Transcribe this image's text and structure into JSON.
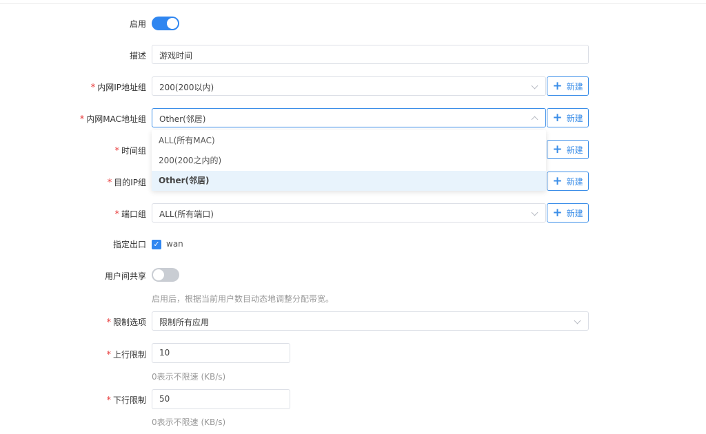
{
  "form": {
    "enable": {
      "label": "启用",
      "on": true
    },
    "description": {
      "label": "描述",
      "value": "游戏时间"
    },
    "ip_group": {
      "required": "*",
      "label": "内网IP地址组",
      "value": "200(200以内)",
      "new_label": "新建"
    },
    "mac_group": {
      "required": "*",
      "label": "内网MAC地址组",
      "value": "Other(邻居)",
      "new_label": "新建",
      "options": [
        "ALL(所有MAC)",
        "200(200之内的)",
        "Other(邻居)"
      ],
      "selected_option": "Other(邻居)"
    },
    "time_group": {
      "required": "*",
      "label": "时间组",
      "new_label": "新建"
    },
    "dest_ip_group": {
      "required": "*",
      "label": "目的IP组",
      "new_label": "新建"
    },
    "port_group": {
      "required": "*",
      "label": "端口组",
      "value": "ALL(所有端口)",
      "new_label": "新建"
    },
    "egress": {
      "label": "指定出口",
      "option": "wan",
      "checked": true
    },
    "user_share": {
      "label": "用户间共享",
      "on": false,
      "help": "启用后，根据当前用户数目动态地调整分配带宽。"
    },
    "limit_option": {
      "required": "*",
      "label": "限制选项",
      "value": "限制所有应用"
    },
    "upload_limit": {
      "required": "*",
      "label": "上行限制",
      "value": "10",
      "help": "0表示不限速 (KB/s)"
    },
    "download_limit": {
      "required": "*",
      "label": "下行限制",
      "value": "50",
      "help": "0表示不限速 (KB/s)"
    }
  },
  "colors": {
    "primary": "#2f86f0",
    "required": "#e83a3a",
    "dropdown_selected_bg": "#e8f3fc"
  },
  "icons": {
    "plus": "+",
    "check": "✓",
    "chevron": "chevron-down-icon"
  }
}
